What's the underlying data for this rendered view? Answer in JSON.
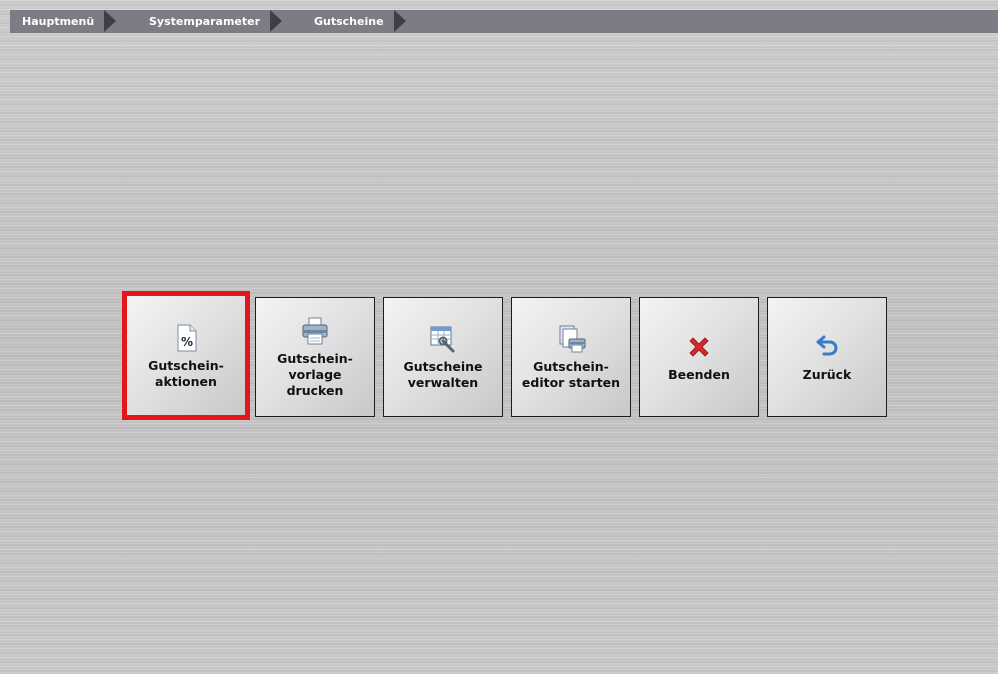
{
  "breadcrumb": {
    "items": [
      "Hauptmenü",
      "Systemparameter",
      "Gutscheine"
    ]
  },
  "buttons": [
    {
      "label": "Gutschein-\naktionen",
      "icon": "percent-document-icon",
      "selected": true
    },
    {
      "label": "Gutschein-\nvorlage\ndrucken",
      "icon": "printer-icon",
      "selected": false
    },
    {
      "label": "Gutscheine\nverwalten",
      "icon": "table-wrench-icon",
      "selected": false
    },
    {
      "label": "Gutschein-\neditor starten",
      "icon": "document-printer-icon",
      "selected": false
    },
    {
      "label": "Beenden",
      "icon": "close-x-icon",
      "selected": false
    },
    {
      "label": "Zurück",
      "icon": "undo-arrow-icon",
      "selected": false
    }
  ],
  "colors": {
    "breadcrumb_bg": "#7c7c84",
    "breadcrumb_arrow": "#3e3e44",
    "selection_frame": "#e3161b",
    "close_icon": "#d8262b",
    "back_icon": "#3a7bc8"
  }
}
